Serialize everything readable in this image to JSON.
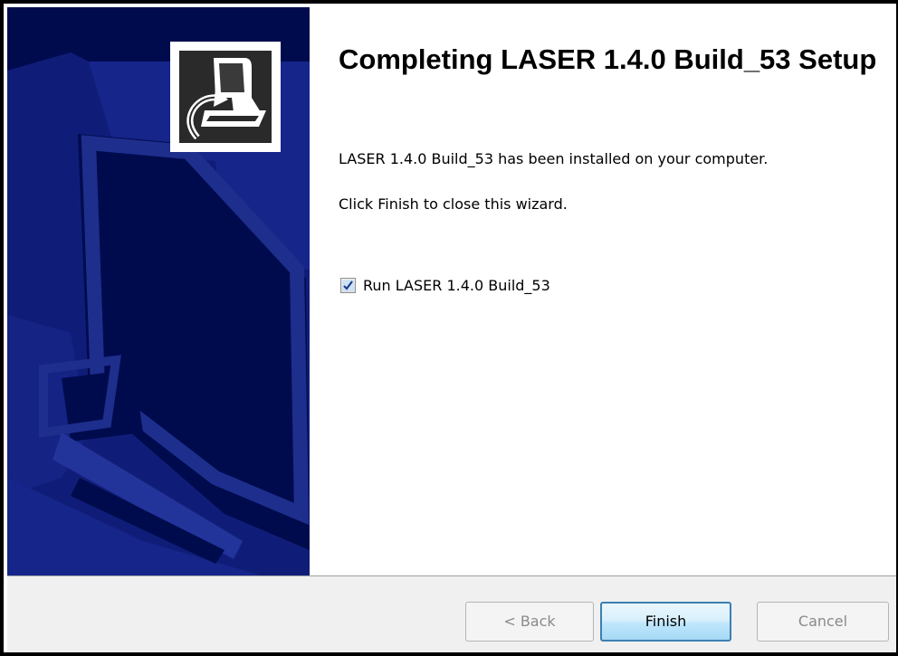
{
  "wizard": {
    "title": "Completing LASER 1.4.0 Build_53 Setup",
    "installed_message": "LASER 1.4.0 Build_53 has been installed on your computer.",
    "finish_instruction": "Click Finish to close this wizard.",
    "run_checkbox": {
      "label": "Run LASER 1.4.0 Build_53",
      "checked": true
    },
    "buttons": {
      "back": "< Back",
      "finish": "Finish",
      "cancel": "Cancel"
    }
  },
  "icons": {
    "installer_logo": "computer-install-icon",
    "checkbox_mark": "checkmark-icon"
  },
  "colors": {
    "banner_background": "#000b4e",
    "banner_shape": "#1e2e8c",
    "default_button_border": "#3c7fb1",
    "footer_background": "#f0f0f0"
  }
}
